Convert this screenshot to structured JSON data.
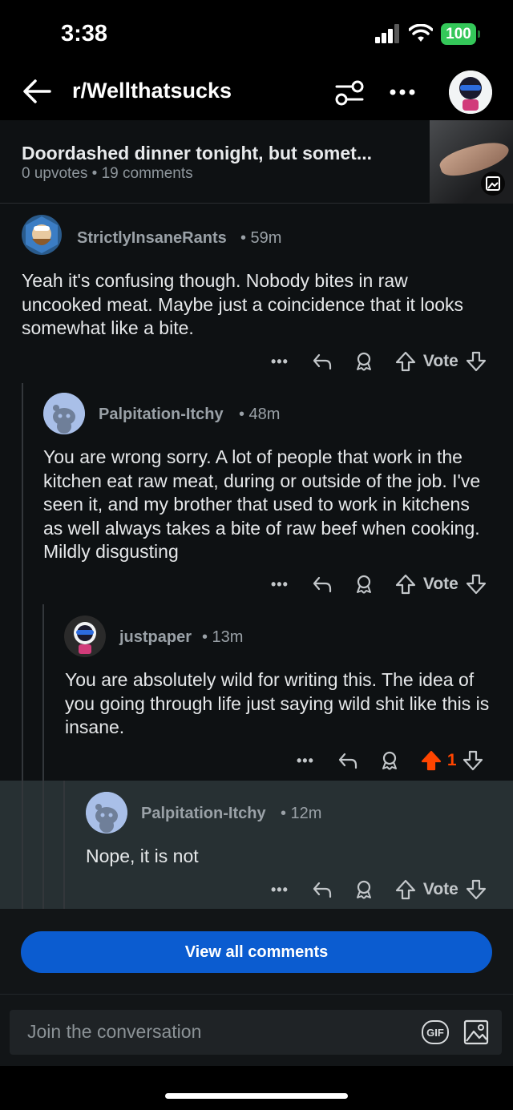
{
  "status_bar": {
    "time": "3:38",
    "battery": "100"
  },
  "header": {
    "subreddit": "r/Wellthatsucks"
  },
  "post": {
    "title": "Doordashed dinner tonight, but somet...",
    "meta": "0 upvotes • 19 comments"
  },
  "comments": [
    {
      "author": "StrictlyInsaneRants",
      "time": "• 59m",
      "body": "Yeah it's confusing though. Nobody bites in raw uncooked meat. Maybe just a coincidence that it looks somewhat like a bite.",
      "vote": "Vote"
    },
    {
      "author": "Palpitation-Itchy",
      "time": "• 48m",
      "body": "You are wrong sorry. A lot of people that work in the kitchen eat raw meat, during or outside of the job. I've seen it, and my brother that used to work in kitchens as well always takes a bite of raw beef when cooking. Mildly disgusting",
      "vote": "Vote"
    },
    {
      "author": "justpaper",
      "time": "• 13m",
      "body": "You are absolutely wild for writing this.  The idea of you going through life just saying wild shit like this is insane.",
      "vote": "1"
    },
    {
      "author": "Palpitation-Itchy",
      "time": "• 12m",
      "body": "Nope, it is not",
      "vote": "Vote"
    }
  ],
  "view_all": "View all comments",
  "composer": {
    "placeholder": "Join the conversation",
    "gif": "GIF"
  },
  "colors": {
    "upvoted": "#ff4500",
    "button": "#0b5cd0"
  }
}
